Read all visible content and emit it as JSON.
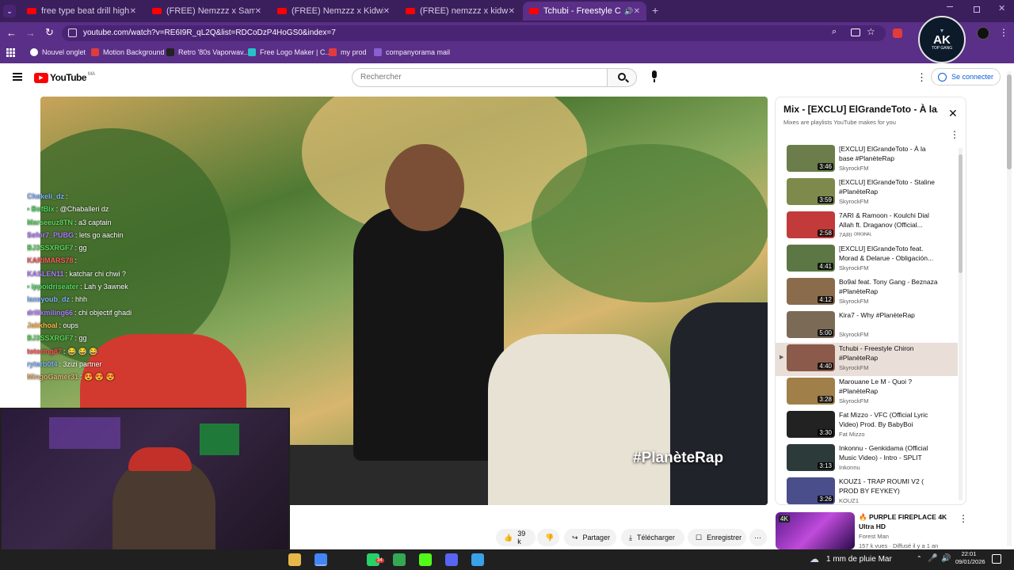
{
  "browser": {
    "tabs": [
      {
        "label": "free type beat drill high - YouTu",
        "active": false
      },
      {
        "label": "(FREE) Nemzzz x Sample x Hoo",
        "active": false
      },
      {
        "label": "(FREE) Nemzzz x Kidwild x Hoo",
        "active": false
      },
      {
        "label": "(FREE) nemzzz x kidwild type be",
        "active": false
      },
      {
        "label": "Tchubi - Freestyle Chiron #",
        "active": true
      }
    ],
    "url": "youtube.com/watch?v=RE6I9R_qL2Q&list=RDCoDzP4HoGS0&index=7",
    "bookmarks": [
      {
        "label": "Nouvel onglet",
        "color": "#ffffff"
      },
      {
        "label": "Motion Background",
        "color": "#e23b3b"
      },
      {
        "label": "Retro '80s Vaporwav...",
        "color": "#222222"
      },
      {
        "label": "Free Logo Maker | C...",
        "color": "#27c1c9"
      },
      {
        "label": "my prod",
        "color": "#e23b3b"
      },
      {
        "label": "companyorama mail",
        "color": "#8a5fd0"
      }
    ],
    "profile_badge": {
      "line1": "AK",
      "line2": "TOP GANG"
    }
  },
  "youtube": {
    "logo_text": "YouTube",
    "region": "MA",
    "search_placeholder": "Rechercher",
    "signin_label": "Se connecter"
  },
  "video": {
    "watermark": "#PlanèteRap",
    "likes": "39 k",
    "share_label": "Partager",
    "download_label": "Télécharger",
    "save_label": "Enregistrer"
  },
  "chat": [
    {
      "user": "Chakeli_dz",
      "msg": ":",
      "color": "#7fb3ff"
    },
    {
      "user": "• BofBix",
      "msg": ": @Chaballeri dz",
      "color": "#4cd964"
    },
    {
      "user": "Marseeuz8TN",
      "msg": ": a3 captain",
      "color": "#5bd75b"
    },
    {
      "user": "Sefor7_PUBG",
      "msg": ": lets go aachin",
      "color": "#b07bff"
    },
    {
      "user": "BJ3SSXRGF7",
      "msg": ": gg",
      "color": "#5bd75b"
    },
    {
      "user": "KARIMARS78",
      "msg": ":",
      "color": "#ff5a5a"
    },
    {
      "user": "KASLEN11",
      "msg": ": katchar chi chwi ?",
      "color": "#b07bff"
    },
    {
      "user": "• ippoidriseater",
      "msg": ": Lah y 3awnek",
      "color": "#4cd964"
    },
    {
      "user": "Iaxeyoub_dz",
      "msg": ": hhh",
      "color": "#7fb3ff"
    },
    {
      "user": "drilikmiling66",
      "msg": ": chi objectif ghadi",
      "color": "#b07bff"
    },
    {
      "user": "Jakkhoal",
      "msg": ": oups",
      "color": "#ffb347"
    },
    {
      "user": "BJ3SSXRGF7",
      "msg": ": gg",
      "color": "#5bd75b"
    },
    {
      "user": "totoring87",
      "msg": ": 😂 😂 😂",
      "color": "#ff4f4f"
    },
    {
      "user": "rytarb0f4",
      "msg": ": 3zizi partner",
      "color": "#7fb3ff"
    },
    {
      "user": "MingoGamer31",
      "msg": ": 😍 😍 😍",
      "color": "#e0b070"
    }
  ],
  "playlist": {
    "title": "Mix - [EXCLU] ElGrandeToto - À la...",
    "subtitle": "Mixes are playlists YouTube makes for you",
    "items": [
      {
        "title": "[EXCLU] ElGrandeToto - À la base #PlanèteRap",
        "channel": "SkyrockFM",
        "duration": "3:46",
        "thumb": "#6a7d4a",
        "current": false
      },
      {
        "title": "[EXCLU] ElGrandeToto - Staline #PlanèteRap",
        "channel": "SkyrockFM",
        "duration": "3:59",
        "thumb": "#7d8a4c",
        "current": false
      },
      {
        "title": "7ARI & Ramoon - Koulchi Dial Allah ft. Draganov (Official...",
        "channel": "7ARI ᴼᴿᴵᴳᴵᴺᴬᴸ",
        "duration": "2:58",
        "thumb": "#c23a3a",
        "current": false
      },
      {
        "title": "[EXCLU] ElGrandeToto feat. Morad & Delarue - Obligación...",
        "channel": "SkyrockFM",
        "duration": "4:41",
        "thumb": "#5d7744",
        "current": false
      },
      {
        "title": "Bo9al feat. Tony Gang - Beznaza #PlanèteRap",
        "channel": "SkyrockFM",
        "duration": "4:12",
        "thumb": "#8a6c4c",
        "current": false
      },
      {
        "title": "Kira7 - Why #PlanèteRap",
        "channel": "SkyrockFM",
        "duration": "5:00",
        "thumb": "#7b6a55",
        "current": false
      },
      {
        "title": "Tchubi - Freestyle Chiron #PlanèteRap",
        "channel": "SkyrockFM",
        "duration": "4:40",
        "thumb": "#8b5a4a",
        "current": true
      },
      {
        "title": "Marouane Le M - Quoi ? #PlanèteRap",
        "channel": "SkyrockFM",
        "duration": "3:28",
        "thumb": "#a08048",
        "current": false
      },
      {
        "title": "Fat Mizzo - VFC (Official Lyric Video) Prod. By BabyBoi",
        "channel": "Fat Mizzo",
        "duration": "3:30",
        "thumb": "#222222",
        "current": false
      },
      {
        "title": "Inkonnu - Genkidama (Official Music Video) - Intro - SPLIT",
        "channel": "Inkonnu",
        "duration": "3:13",
        "thumb": "#2c3a3a",
        "current": false
      },
      {
        "title": "KOUZ1 - TRAP ROUMI V2 ( PROD BY FEYKEY)",
        "channel": "KOUZ1",
        "duration": "3:26",
        "thumb": "#4a4e8a",
        "current": false
      }
    ]
  },
  "suggestion": {
    "badge": "4K",
    "title": "🔥 PURPLE FIREPLACE 4K Ultra HD",
    "channel": "Forest Man",
    "meta": "157 k vues · Diffusé il y a 1 an"
  },
  "taskbar": {
    "weather": "1 mm de pluie Mar",
    "time": "22:01",
    "date": "09/01/2026",
    "badge_count": "34",
    "apps": [
      {
        "name": "folder",
        "color": "#e6b84a"
      },
      {
        "name": "chrome",
        "color": "#4285f4"
      },
      {
        "name": "obs",
        "color": "#202020"
      },
      {
        "name": "whatsapp",
        "color": "#25d366"
      },
      {
        "name": "chrome",
        "color": "#34a853"
      },
      {
        "name": "kick",
        "color": "#53fc18"
      },
      {
        "name": "discord",
        "color": "#5865f2"
      },
      {
        "name": "app",
        "color": "#3aa0e8"
      }
    ]
  }
}
